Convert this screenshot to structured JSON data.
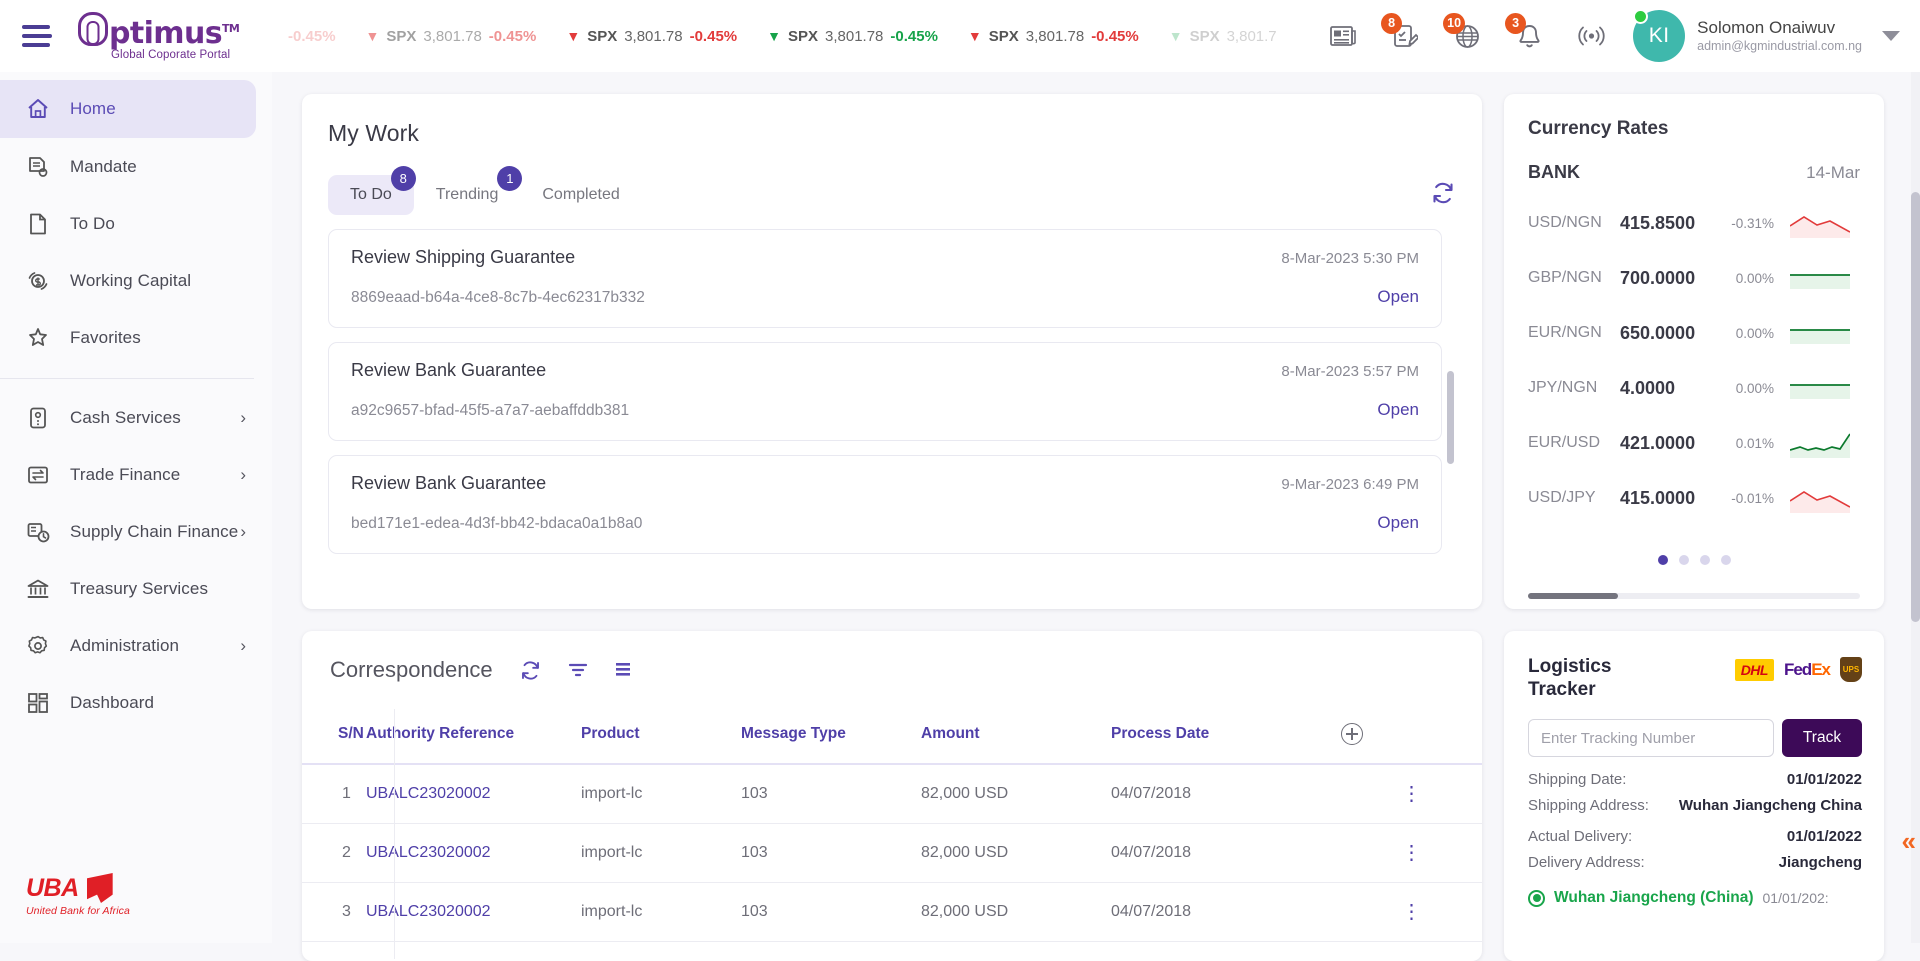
{
  "brand": {
    "name": "ptimus",
    "tm": "TM",
    "tagline": "Global Coporate Portal"
  },
  "ticker": [
    {
      "symbol": "",
      "price": "",
      "change": "-0.45%",
      "dir": "down",
      "fade": "t-fade3"
    },
    {
      "symbol": "SPX",
      "price": "3,801.78",
      "change": "-0.45%",
      "dir": "down",
      "fade": "t-fade2"
    },
    {
      "symbol": "SPX",
      "price": "3,801.78",
      "change": "-0.45%",
      "dir": "down",
      "fade": ""
    },
    {
      "symbol": "SPX",
      "price": "3,801.78",
      "change": "-0.45%",
      "dir": "up",
      "fade": ""
    },
    {
      "symbol": "SPX",
      "price": "3,801.78",
      "change": "-0.45%",
      "dir": "down",
      "fade": ""
    },
    {
      "symbol": "SPX",
      "price": "3,801.7",
      "change": "",
      "dir": "up",
      "fade": "t-fade1"
    }
  ],
  "header": {
    "icons": [
      {
        "name": "news-icon",
        "badge": ""
      },
      {
        "name": "task-edit-icon",
        "badge": "8"
      },
      {
        "name": "globe-icon",
        "badge": "10"
      },
      {
        "name": "bell-icon",
        "badge": "3"
      },
      {
        "name": "broadcast-icon",
        "badge": ""
      }
    ],
    "user": {
      "initials": "KI",
      "name": "Solomon Onaiwuv",
      "email": "admin@kgmindustrial.com.ng"
    }
  },
  "sidebar": {
    "items": [
      {
        "label": "Home",
        "icon": "home-icon",
        "active": true,
        "chevron": false
      },
      {
        "label": "Mandate",
        "icon": "document-badge-icon",
        "active": false,
        "chevron": false
      },
      {
        "label": "To Do",
        "icon": "file-icon",
        "active": false,
        "chevron": false
      },
      {
        "label": "Working Capital",
        "icon": "dollar-cycle-icon",
        "active": false,
        "chevron": false
      },
      {
        "label": "Favorites",
        "icon": "star-icon",
        "active": false,
        "chevron": false
      },
      {
        "label": "Cash Services",
        "icon": "cash-icon",
        "active": false,
        "chevron": true
      },
      {
        "label": "Trade Finance",
        "icon": "exchange-icon",
        "active": false,
        "chevron": true
      },
      {
        "label": "Supply Chain Finance",
        "icon": "supply-clock-icon",
        "active": false,
        "chevron": true
      },
      {
        "label": "Treasury Services",
        "icon": "bank-icon",
        "active": false,
        "chevron": false
      },
      {
        "label": "Administration",
        "icon": "gear-icon",
        "active": false,
        "chevron": true
      },
      {
        "label": "Dashboard",
        "icon": "dashboard-icon",
        "active": false,
        "chevron": false
      }
    ],
    "footer_logo": {
      "text": "UBA",
      "tagline": "United Bank for Africa"
    }
  },
  "my_work": {
    "title": "My Work",
    "tabs": [
      {
        "label": "To Do",
        "badge": "8",
        "active": true
      },
      {
        "label": "Trending",
        "badge": "1",
        "active": false
      },
      {
        "label": "Completed",
        "badge": "",
        "active": false
      }
    ],
    "tasks": [
      {
        "title": "Review Shipping Guarantee",
        "date": "8-Mar-2023 5:30 PM",
        "id": "8869eaad-b64a-4ce8-8c7b-4ec62317b332",
        "action": "Open"
      },
      {
        "title": "Review Bank Guarantee",
        "date": "8-Mar-2023 5:57 PM",
        "id": "a92c9657-bfad-45f5-a7a7-aebaffddb381",
        "action": "Open"
      },
      {
        "title": "Review Bank Guarantee",
        "date": "9-Mar-2023 6:49 PM",
        "id": "bed171e1-edea-4d3f-bb42-bdaca0a1b8a0",
        "action": "Open"
      }
    ]
  },
  "correspondence": {
    "title": "Correspondence",
    "columns": [
      "S/N",
      "Authority Reference",
      "Product",
      "Message Type",
      "Amount",
      "Process Date"
    ],
    "rows": [
      {
        "sn": "1",
        "ref": "UBALC23020002",
        "product": "import-lc",
        "msg": "103",
        "amount": "82,000 USD",
        "date": "04/07/2018"
      },
      {
        "sn": "2",
        "ref": "UBALC23020002",
        "product": "import-lc",
        "msg": "103",
        "amount": "82,000 USD",
        "date": "04/07/2018"
      },
      {
        "sn": "3",
        "ref": "UBALC23020002",
        "product": "import-lc",
        "msg": "103",
        "amount": "82,000 USD",
        "date": "04/07/2018"
      }
    ]
  },
  "currency_rates": {
    "title": "Currency Rates",
    "source": "BANK",
    "date": "14-Mar",
    "rows": [
      {
        "pair": "USD/NGN",
        "value": "415.8500",
        "change": "-0.31%",
        "trend": "down"
      },
      {
        "pair": "GBP/NGN",
        "value": "700.0000",
        "change": "0.00%",
        "trend": "flat"
      },
      {
        "pair": "EUR/NGN",
        "value": "650.0000",
        "change": "0.00%",
        "trend": "flat"
      },
      {
        "pair": "JPY/NGN",
        "value": "4.0000",
        "change": "0.00%",
        "trend": "flat"
      },
      {
        "pair": "EUR/USD",
        "value": "421.0000",
        "change": "0.01%",
        "trend": "up"
      },
      {
        "pair": "USD/JPY",
        "value": "415.0000",
        "change": "-0.01%",
        "trend": "down"
      }
    ],
    "pages": 4,
    "active_page": 1
  },
  "logistics": {
    "title": "Logistics Tracker",
    "carriers": [
      "DHL",
      "FedEx",
      "UPS"
    ],
    "tracking_placeholder": "Enter Tracking Number",
    "tracking_value": "",
    "track_button": "Track",
    "details": [
      {
        "key": "Shipping Date:",
        "value": "01/01/2022"
      },
      {
        "key": "Shipping Address:",
        "value": "Wuhan Jiangcheng China"
      },
      {
        "key": "Actual Delivery:",
        "value": "01/01/2022"
      },
      {
        "key": "Delivery Address:",
        "value": "Jiangcheng"
      }
    ],
    "events": [
      {
        "location": "Wuhan Jiangcheng (China)",
        "date": "01/01/202:"
      }
    ]
  },
  "colors": {
    "purple": "#4f3fa8",
    "brand_purple": "#6d2f8f",
    "orange_badge": "#e8561f",
    "teal_avatar": "#3fb8ac",
    "uba_red": "#e01f26",
    "green": "#17a34a",
    "red": "#e23b3b",
    "collapse_orange": "#f26722"
  }
}
